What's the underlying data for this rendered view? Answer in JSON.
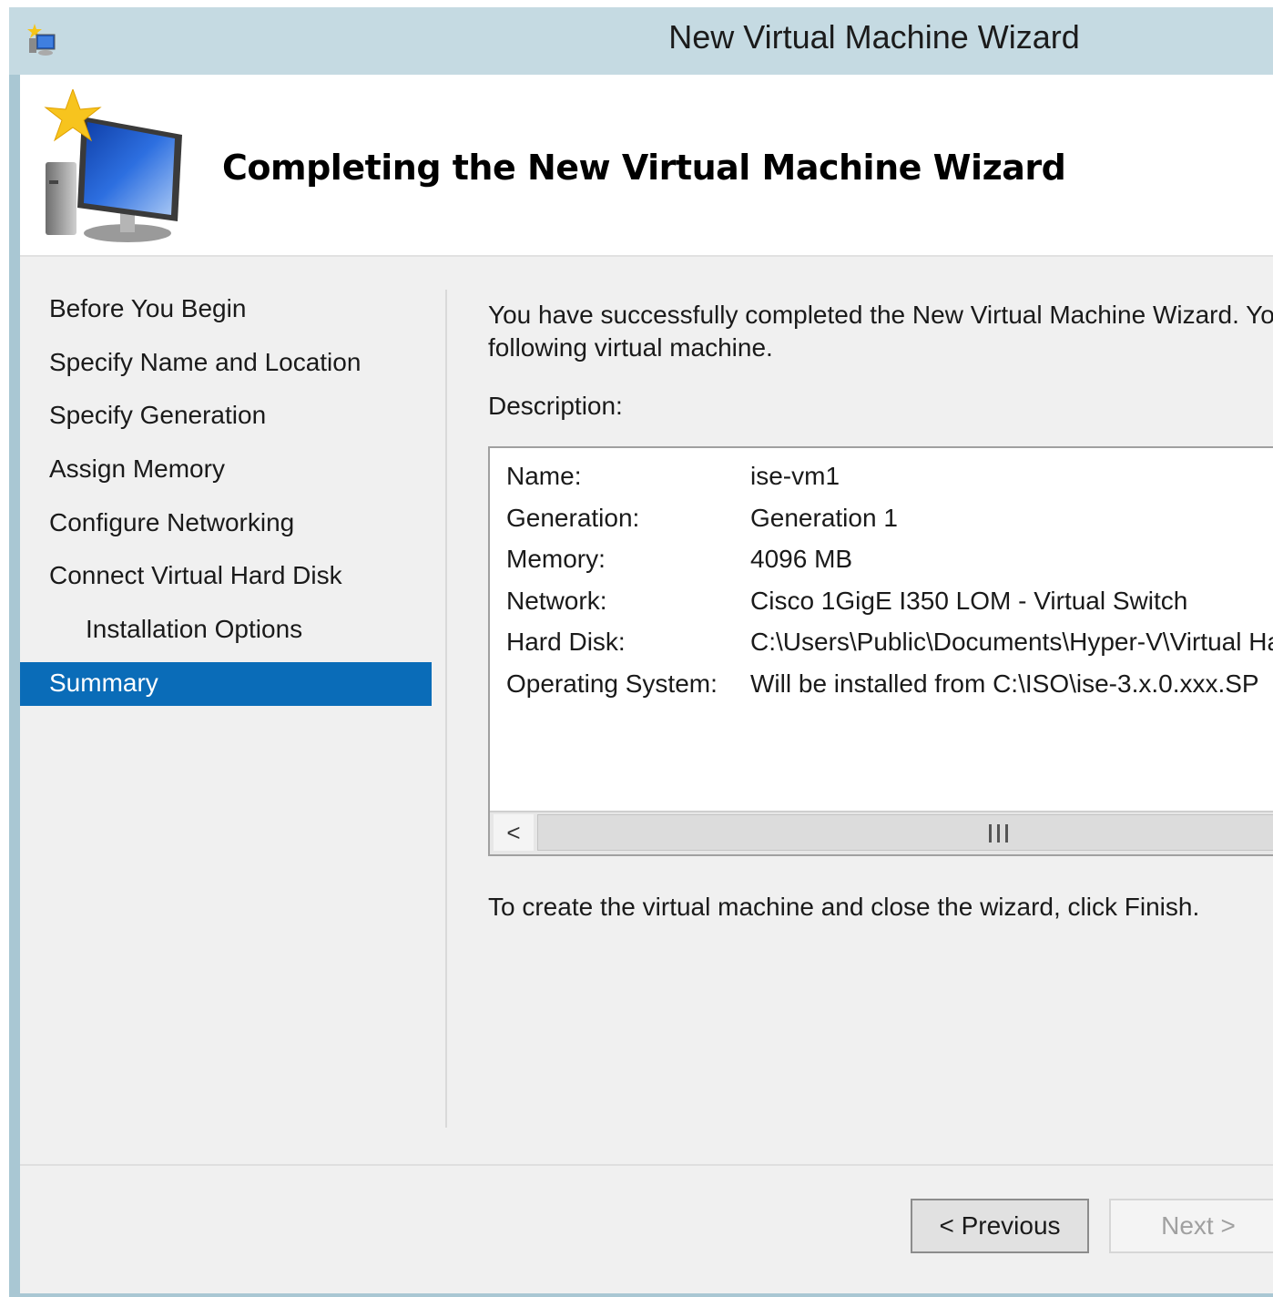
{
  "window": {
    "title": "New Virtual Machine Wizard",
    "icon": "hyperv-wizard-icon"
  },
  "header": {
    "title": "Completing the New Virtual Machine Wizard",
    "icon": "new-vm-monitor-star-icon"
  },
  "steps": [
    {
      "label": "Before You Begin",
      "active": false
    },
    {
      "label": "Specify Name and Location",
      "active": false
    },
    {
      "label": "Specify Generation",
      "active": false
    },
    {
      "label": "Assign Memory",
      "active": false
    },
    {
      "label": "Configure Networking",
      "active": false
    },
    {
      "label": "Connect Virtual Hard Disk",
      "active": false
    },
    {
      "label": "Installation Options",
      "active": false,
      "sub": true
    },
    {
      "label": "Summary",
      "active": true
    }
  ],
  "main": {
    "intro_line1": "You have successfully completed the New Virtual Machine Wizard. Yo",
    "intro_line2": "following virtual machine.",
    "description_label": "Description:",
    "description": [
      {
        "key": "Name:",
        "value": "ise-vm1"
      },
      {
        "key": "Generation:",
        "value": "Generation 1"
      },
      {
        "key": "Memory:",
        "value": "4096 MB"
      },
      {
        "key": "Network:",
        "value": "Cisco 1GigE I350 LOM - Virtual Switch"
      },
      {
        "key": "Hard Disk:",
        "value": "C:\\Users\\Public\\Documents\\Hyper-V\\Virtual Ha"
      },
      {
        "key": "Operating System:",
        "value": "Will be installed from C:\\ISO\\ise-3.x.0.xxx.SP"
      }
    ],
    "scroll_left_glyph": "<",
    "finish_note": "To create the virtual machine and close the wizard, click Finish."
  },
  "buttons": {
    "previous": "< Previous",
    "next": "Next >"
  },
  "colors": {
    "titlebar": "#c5dae2",
    "selected_step": "#0a6cb8",
    "panel": "#f0f0f0"
  }
}
